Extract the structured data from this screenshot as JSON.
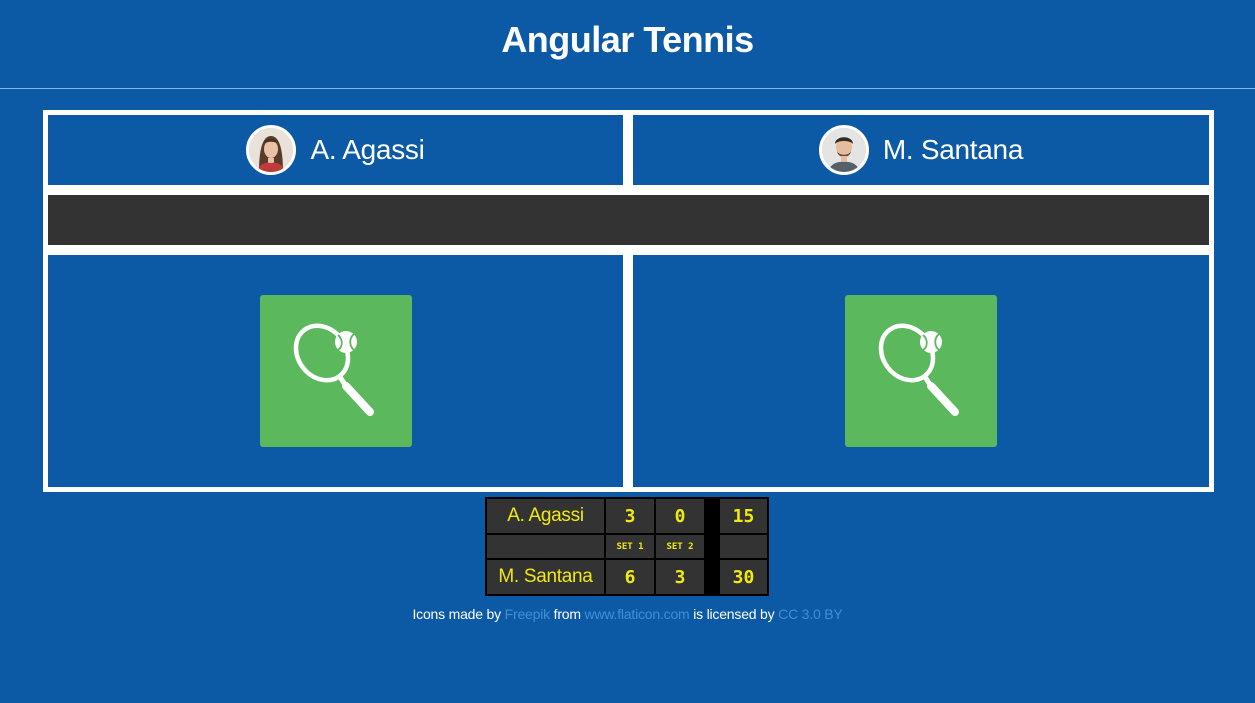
{
  "header": {
    "title": "Angular Tennis"
  },
  "players": [
    {
      "name": "A. Agassi",
      "avatar_icon": "avatar-woman-icon"
    },
    {
      "name": "M. Santana",
      "avatar_icon": "avatar-man-icon"
    }
  ],
  "hit_button": {
    "icon": "tennis-racket-icon"
  },
  "scoreboard": {
    "rows": [
      {
        "name": "A. Agassi",
        "set1": "3",
        "set2": "0",
        "game": "15"
      },
      {
        "name": "M. Santana",
        "set1": "6",
        "set2": "3",
        "game": "30"
      }
    ],
    "set_labels": [
      "SET 1",
      "SET 2"
    ]
  },
  "footer": {
    "prefix": "Icons made by",
    "author": "Freepik",
    "from": "from",
    "site": "www.flaticon.com",
    "licensed": "is licensed by",
    "license": "CC 3.0 BY"
  },
  "colors": {
    "background": "#0c5aa6",
    "button": "#5cb85c",
    "score_text": "#f2e90f",
    "net": "#333333"
  }
}
